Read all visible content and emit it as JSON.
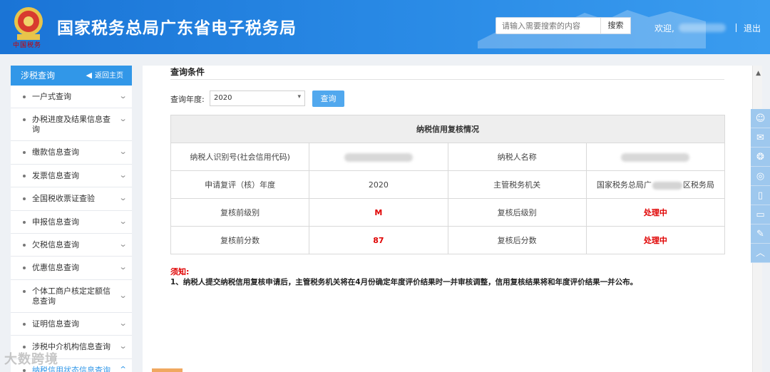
{
  "header": {
    "emblem_text": "中国税务",
    "title": "国家税务总局广东省电子税务局",
    "search_placeholder": "请输入需要搜索的内容",
    "search_button": "搜索",
    "welcome": "欢迎,",
    "logout": "退出"
  },
  "sidebar": {
    "title": "涉税查询",
    "back_home": "返回主页",
    "items": [
      {
        "label": "一户式查询"
      },
      {
        "label": "办税进度及结果信息查询"
      },
      {
        "label": "缴款信息查询"
      },
      {
        "label": "发票信息查询"
      },
      {
        "label": "全国税收票证查验"
      },
      {
        "label": "申报信息查询"
      },
      {
        "label": "欠税信息查询"
      },
      {
        "label": "优惠信息查询"
      },
      {
        "label": "个体工商户核定定额信息查询"
      },
      {
        "label": "证明信息查询"
      },
      {
        "label": "涉税中介机构信息查询"
      },
      {
        "label": "纳税信用状态信息查询"
      }
    ]
  },
  "main": {
    "section_title": "查询条件",
    "year_label": "查询年度:",
    "year_value": "2020",
    "query_button": "查询",
    "table": {
      "caption": "纳税信用复核情况",
      "taxpayer_id_label": "纳税人识别号(社会信用代码)",
      "taxpayer_name_label": "纳税人名称",
      "review_year_label": "申请复评（核）年度",
      "review_year_value": "2020",
      "tax_authority_label": "主管税务机关",
      "tax_authority_prefix": "国家税务总局广",
      "tax_authority_suffix": "区税务局",
      "level_before_label": "复核前级别",
      "level_before_value": "M",
      "level_after_label": "复核后级别",
      "level_after_value": "处理中",
      "score_before_label": "复核前分数",
      "score_before_value": "87",
      "score_after_label": "复核后分数",
      "score_after_value": "处理中"
    },
    "notice_title": "须知:",
    "notice_text": "1、纳税人提交纳税信用复核申请后，主管税务机关将在4月份确定年度评价结果时一并审核调整，信用复核结果将和年度评价结果一并公布。"
  },
  "float_bar": {
    "icons": [
      "user-star-icon",
      "chat-icon",
      "wechat-icon",
      "weibo-icon",
      "mobile-icon",
      "tablet-icon",
      "edit-icon",
      "back-to-top-icon"
    ]
  },
  "watermark": "大数跨境",
  "colors": {
    "header_blue": "#2a8be6",
    "sidebar_head": "#3197e8",
    "query_button": "#51a8ee",
    "alert_red": "#e00000"
  }
}
